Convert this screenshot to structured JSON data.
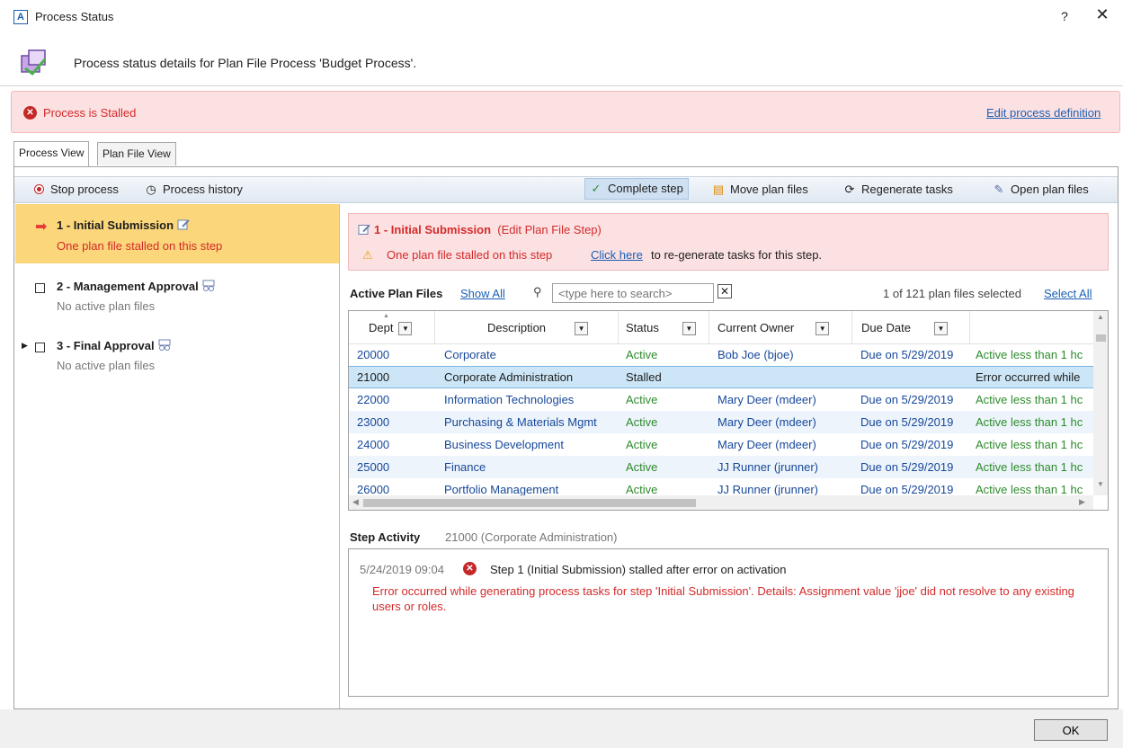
{
  "window": {
    "title": "Process Status",
    "app_badge": "A",
    "help": "?",
    "close": "✕"
  },
  "header": {
    "text": "Process status details for Plan File Process 'Budget Process'."
  },
  "status_banner": {
    "text": "Process is Stalled",
    "edit_link": "Edit process definition"
  },
  "tabs": [
    {
      "label": "Process View",
      "active": true
    },
    {
      "label": "Plan File View",
      "active": false
    }
  ],
  "toolbar": {
    "stop": "Stop process",
    "history": "Process history",
    "complete": "Complete step",
    "move": "Move plan files",
    "regenerate": "Regenerate tasks",
    "open": "Open plan files"
  },
  "steps": [
    {
      "title": "1 - Initial Submission",
      "sub": "One plan file stalled on this step"
    },
    {
      "title": "2 - Management Approval",
      "sub": "No active plan files"
    },
    {
      "title": "3 - Final Approval",
      "sub": "No active plan files"
    }
  ],
  "step_banner": {
    "title": "1 - Initial Submission",
    "type": "(Edit Plan File Step)",
    "message": "One plan file stalled on this step",
    "link": "Click here",
    "rest": "to re-generate tasks for this step."
  },
  "active_plan_files": {
    "label": "Active Plan Files",
    "show_all": "Show All",
    "search_placeholder": "<type here to search>",
    "clear": "✕",
    "selection": "1 of 121 plan files selected",
    "select_all": "Select All"
  },
  "grid": {
    "columns": [
      "Dept",
      "Description",
      "Status",
      "Current Owner",
      "Due Date",
      ""
    ],
    "rows": [
      {
        "dept": "20000",
        "description": "Corporate",
        "status": "Active",
        "owner": "Bob Joe (bjoe)",
        "due": "Due on 5/29/2019",
        "note": "Active less than 1 hc"
      },
      {
        "dept": "21000",
        "description": "Corporate Administration",
        "status": "Stalled",
        "owner": "",
        "due": "",
        "note": "Error occurred while"
      },
      {
        "dept": "22000",
        "description": "Information Technologies",
        "status": "Active",
        "owner": "Mary Deer (mdeer)",
        "due": "Due on 5/29/2019",
        "note": "Active less than 1 hc"
      },
      {
        "dept": "23000",
        "description": "Purchasing & Materials Mgmt",
        "status": "Active",
        "owner": "Mary Deer (mdeer)",
        "due": "Due on 5/29/2019",
        "note": "Active less than 1 hc"
      },
      {
        "dept": "24000",
        "description": "Business Development",
        "status": "Active",
        "owner": "Mary Deer (mdeer)",
        "due": "Due on 5/29/2019",
        "note": "Active less than 1 hc"
      },
      {
        "dept": "25000",
        "description": "Finance",
        "status": "Active",
        "owner": "JJ Runner (jrunner)",
        "due": "Due on 5/29/2019",
        "note": "Active less than 1 hc"
      },
      {
        "dept": "26000",
        "description": "Portfolio Management",
        "status": "Active",
        "owner": "JJ Runner (jrunner)",
        "due": "Due on 5/29/2019",
        "note": "Active less than 1 hc"
      }
    ]
  },
  "step_activity": {
    "label": "Step Activity",
    "context": "21000 (Corporate Administration)",
    "time": "5/24/2019 09:04",
    "message": "Step 1 (Initial Submission) stalled after error on activation",
    "detail": "Error occurred while generating process tasks for step 'Initial Submission'.  Details: Assignment value 'jjoe' did not resolve to any existing users or roles."
  },
  "footer": {
    "ok": "OK"
  },
  "colors": {
    "error_red": "#d42a2a",
    "active_green": "#2e8b2e",
    "selected_step": "#fbd67a",
    "banner_bg": "#fce1e2",
    "link_blue": "#1a5fb4"
  }
}
